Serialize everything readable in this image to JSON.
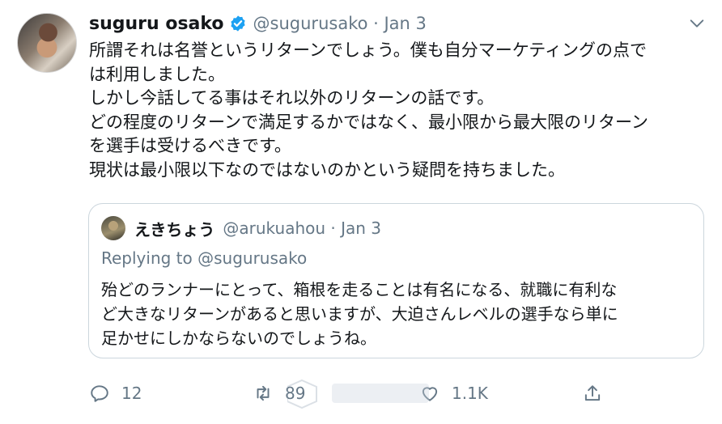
{
  "tweet": {
    "author_name": "suguru osako",
    "handle_and_date": "@sugurusako · Jan 3",
    "lines": [
      "所謂それは名誉というリターンでしょう。僕も自分マーケティングの点で",
      "は利用しました。",
      "しかし今話してる事はそれ以外のリターンの話です。",
      "どの程度のリターンで満足するかではなく、最小限から最大限のリターン",
      "を選手は受けるべきです。",
      "現状は最小限以下なのではないのかという疑問を持ちました。"
    ]
  },
  "quote": {
    "author_name": "えきちょう",
    "handle_and_date": "@arukuahou · Jan 3",
    "replying_to": "Replying to @sugurusako",
    "lines": [
      "殆どのランナーにとって、箱根を走ることは有名になる、就職に有利な",
      "ど大きなリターンがあると思いますが、大迫さんレベルの選手なら単に",
      "足かせにしかならないのでしょうね。"
    ]
  },
  "actions": {
    "reply_count": "12",
    "retweet_count": "89",
    "like_count": "1.1K"
  },
  "colors": {
    "verified": "#1da1f2",
    "secondary_text": "#657786",
    "border": "#ccd6dd"
  },
  "icons": [
    "verified-badge-icon",
    "chevron-down-icon",
    "reply-icon",
    "retweet-icon",
    "like-icon",
    "share-icon"
  ]
}
